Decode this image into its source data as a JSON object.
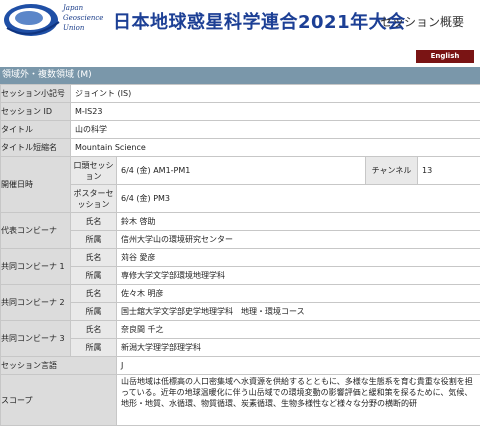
{
  "header": {
    "logo_lines": [
      "Japan",
      "Geoscience",
      "Union"
    ],
    "title": "日本地球惑星科学連合2021年大会",
    "subtitle": "セッション概要"
  },
  "language_button": "English",
  "section": "領域外・複数領域 (M)",
  "rows": {
    "session_symbol": {
      "label": "セッション小記号",
      "value": "ジョイント (IS)"
    },
    "session_id": {
      "label": "セッション ID",
      "value": "M-IS23"
    },
    "title": {
      "label": "タイトル",
      "value": "山の科学"
    },
    "title_short": {
      "label": "タイトル短縮名",
      "value": "Mountain Science"
    }
  },
  "schedule": {
    "label": "開催日時",
    "oral_label": "口頭セッション",
    "oral_value": "6/4 (金) AM1-PM1",
    "channel_label": "チャンネル",
    "channel_value": "13",
    "poster_label": "ポスターセッション",
    "poster_value": "6/4 (金) PM3"
  },
  "conveners": [
    {
      "label": "代表コンビーナ",
      "name_label": "氏名",
      "name": "鈴木 啓助",
      "affil_label": "所属",
      "affil": "信州大学山の環境研究センター"
    },
    {
      "label": "共同コンビーナ 1",
      "name_label": "氏名",
      "name": "苅谷 愛彦",
      "affil_label": "所属",
      "affil": "専修大学文学部環境地理学科"
    },
    {
      "label": "共同コンビーナ 2",
      "name_label": "氏名",
      "name": "佐々木 明彦",
      "affil_label": "所属",
      "affil": "国士舘大学文学部史学地理学科　地理・環境コース"
    },
    {
      "label": "共同コンビーナ 3",
      "name_label": "氏名",
      "name": "奈良間 千之",
      "affil_label": "所属",
      "affil": "新潟大学理学部理学科"
    }
  ],
  "language": {
    "label": "セッション言語",
    "value": "J"
  },
  "scope": {
    "label": "スコープ",
    "value": "山岳地域は低標高の人口密集域へ水資源を供給するとともに、多様な生態系を育む貴重な役割を担っている。近年の地球温暖化に伴う山岳域での環境変動の影響評価と緩和策を探るために、気候、地形・地質、水循環、物質循環、炭素循環、生物多様性など様々な分野の横断的研"
  }
}
